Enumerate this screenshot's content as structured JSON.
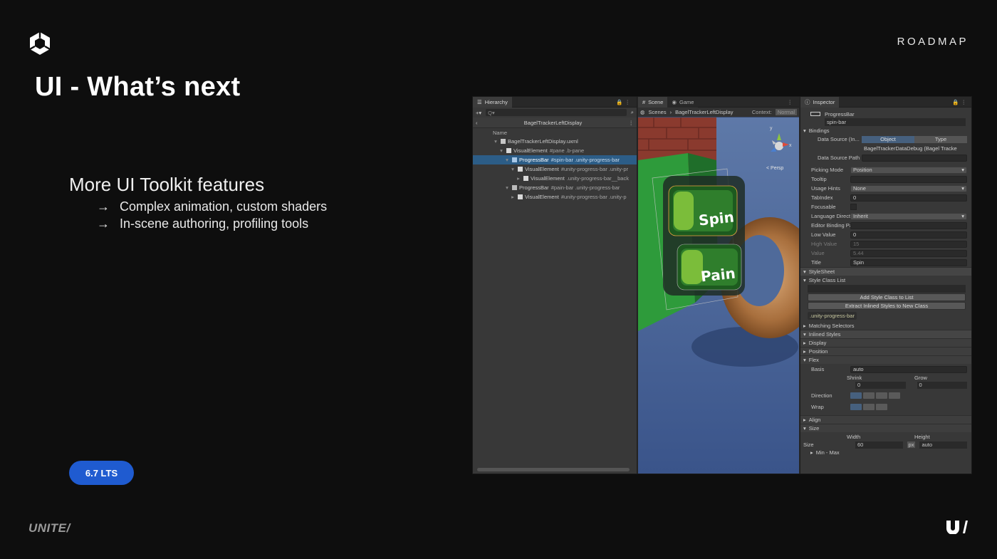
{
  "slide": {
    "section_label": "ROADMAP",
    "title": "UI - What’s next",
    "subhead": "More UI Toolkit features",
    "bullets": [
      "Complex animation, custom shaders",
      "In-scene authoring, profiling tools"
    ],
    "bullet_arrow": "→",
    "badge": "6.7 LTS",
    "footer_brand": "UNITE/",
    "colors": {
      "background": "#0e0e0e",
      "badge": "#1f5bd0",
      "footer_brand": "#9a9a9a"
    }
  },
  "editor": {
    "hierarchy": {
      "tab_label": "Hierarchy",
      "scene_name": "BagelTrackerLeftDisplay",
      "column_name": "Name",
      "rows": [
        {
          "name": "BagelTrackerLeftDisplay.uxml",
          "cls": ""
        },
        {
          "name": "VisualElement",
          "cls": "#pane .b-pane"
        },
        {
          "name": "ProgressBar",
          "cls": "#spin-bar .unity-progress-bar"
        },
        {
          "name": "VisualElement",
          "cls": "#unity-progress-bar .unity-pr"
        },
        {
          "name": "VisualElement",
          "cls": ".unity-progress-bar__back"
        },
        {
          "name": "ProgressBar",
          "cls": "#pain-bar .unity-progress-bar"
        },
        {
          "name": "VisualElement",
          "cls": "#unity-progress-bar .unity-p"
        }
      ]
    },
    "scene": {
      "tab_scene": "Scene",
      "tab_game": "Game",
      "crumb_root": "Scenes",
      "crumb_name": "BagelTrackerLeftDisplay",
      "context_label": "Context:",
      "context_value": "Normal",
      "persp_label": "< Persp",
      "gizmo_y": "y",
      "gizmo_x": "x",
      "bar1_label": "Spin",
      "bar2_label": "Pain",
      "bar_colors": {
        "frame": "#1d5a1f",
        "fill": "#7bbd3a",
        "text": "#ffffff"
      }
    },
    "inspector": {
      "tab_label": "Inspector",
      "type_name": "ProgressBar",
      "element_name": "spin-bar",
      "bindings_section": "Bindings",
      "data_source_label": "Data Source (In...",
      "data_source_toggle_object": "Object",
      "data_source_toggle_type": "Type",
      "data_source_value": "BagelTrackerDataDebug (Bagel Tracke",
      "data_source_path_label": "Data Source Path",
      "fields": [
        {
          "label": "Picking Mode",
          "value": "Position",
          "kind": "drop"
        },
        {
          "label": "Tooltip",
          "value": "",
          "kind": "text"
        },
        {
          "label": "Usage Hints",
          "value": "None",
          "kind": "drop"
        },
        {
          "label": "TabIndex",
          "value": "0",
          "kind": "text"
        },
        {
          "label": "Focusable",
          "value": "",
          "kind": "check"
        },
        {
          "label": "Language Directi...",
          "value": "Inherit",
          "kind": "drop"
        },
        {
          "label": "Editor Binding Path",
          "value": "",
          "kind": "text"
        },
        {
          "label": "Low Value",
          "value": "0",
          "kind": "text"
        },
        {
          "label": "High Value",
          "value": "15",
          "kind": "dim"
        },
        {
          "label": "Value",
          "value": "5.44",
          "kind": "dim"
        },
        {
          "label": "Title",
          "value": "Spin",
          "kind": "text"
        }
      ],
      "stylesheet_section": "StyleSheet",
      "style_class_list": "Style Class List",
      "add_class_button": "Add Style Class to List",
      "extract_button": "Extract Inlined Styles to New Class",
      "class_chip": ".unity-progress-bar",
      "matching_selectors": "Matching Selectors",
      "inlined_styles": "Inlined Styles",
      "display_section": "Display",
      "position_section": "Position",
      "flex_section": "Flex",
      "basis_label": "Basis",
      "basis_value": "auto",
      "shrink_label": "Shrink",
      "shrink_value": "0",
      "grow_label": "Grow",
      "grow_value": "0",
      "direction_label": "Direction",
      "wrap_label": "Wrap",
      "align_section": "Align",
      "size_section": "Size",
      "width_label": "Width",
      "height_label": "Height",
      "size_label": "Size",
      "size_width_value": "60",
      "size_width_unit": "px",
      "size_height_value": "auto",
      "min_max_label": "Min - Max"
    }
  }
}
